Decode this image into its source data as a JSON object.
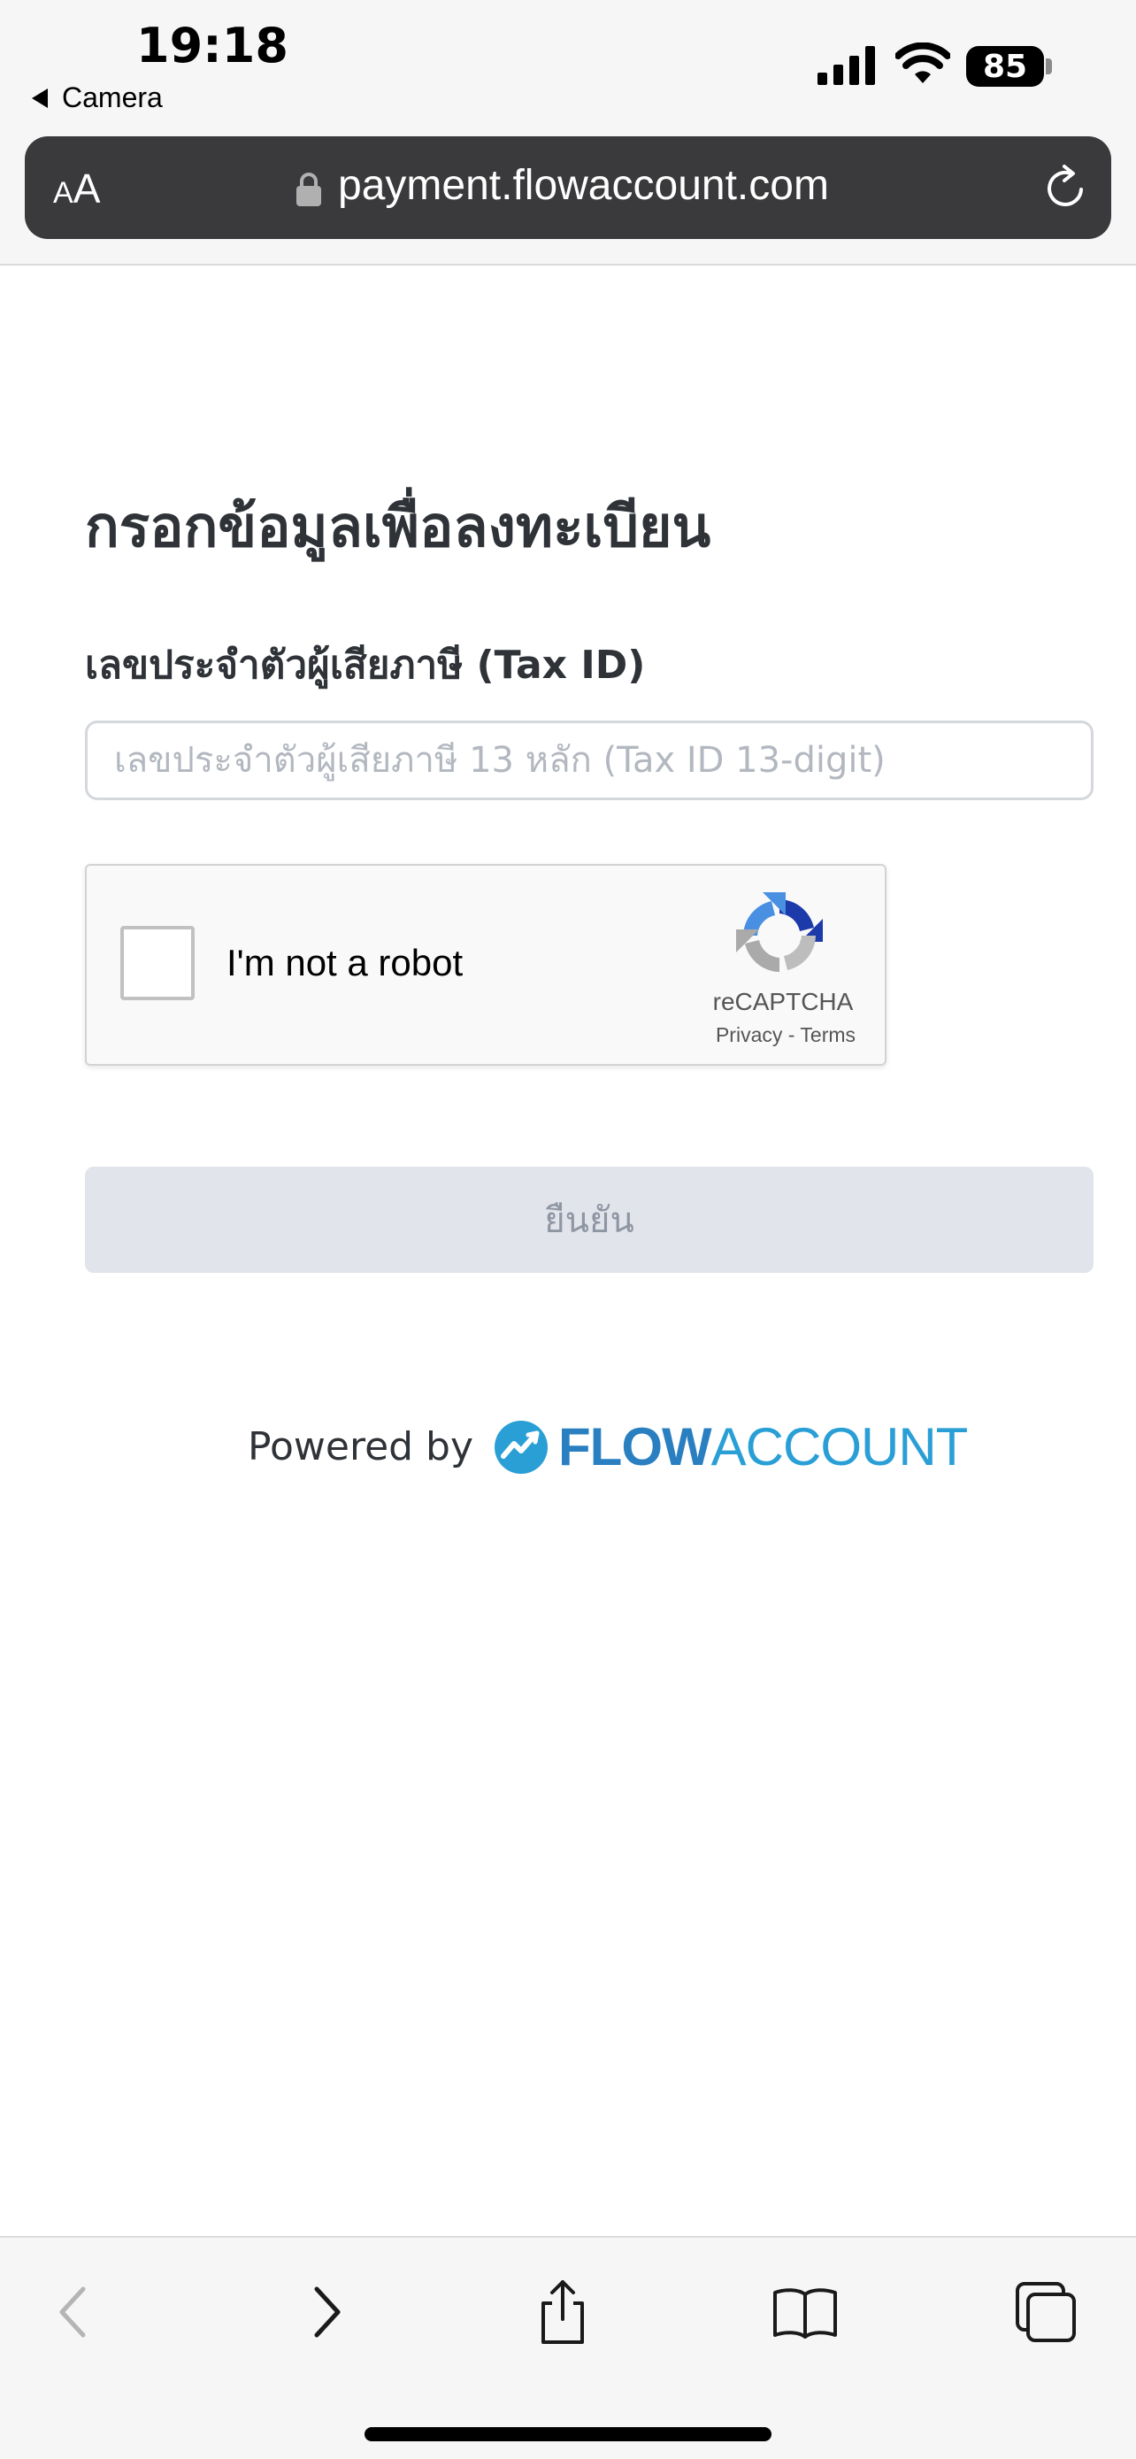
{
  "status_bar": {
    "time": "19:18",
    "back_app": "Camera",
    "battery": "85"
  },
  "browser": {
    "text_size_small": "A",
    "text_size_big": "A",
    "url": "payment.flowaccount.com"
  },
  "form": {
    "title": "กรอกข้อมูลเพื่อลงทะเบียน",
    "tax_label": "เลขประจำตัวผู้เสียภาษี (Tax ID)",
    "tax_placeholder": "เลขประจำตัวผู้เสียภาษี 13 หลัก (Tax ID 13-digit)",
    "tax_value": "",
    "confirm_label": "ยืนยัน"
  },
  "recaptcha": {
    "label": "I'm not a robot",
    "brand": "reCAPTCHA",
    "privacy": "Privacy",
    "separator": "-",
    "terms": "Terms"
  },
  "footer": {
    "powered_by": "Powered by",
    "brand_flow": "FLOW",
    "brand_account": "ACCOUNT"
  },
  "icons": {
    "status": [
      "cellular-signal-icon",
      "wifi-icon",
      "battery-icon"
    ],
    "browser": [
      "lock-icon",
      "reload-icon"
    ],
    "toolbar": [
      "back-icon",
      "forward-icon",
      "share-icon",
      "bookmarks-icon",
      "tabs-icon"
    ]
  },
  "colors": {
    "brand_blue": "#2a9fd6",
    "button_disabled_bg": "#e1e4ea",
    "button_disabled_text": "#8f96a3",
    "url_bar_bg": "#3a3a3c"
  }
}
